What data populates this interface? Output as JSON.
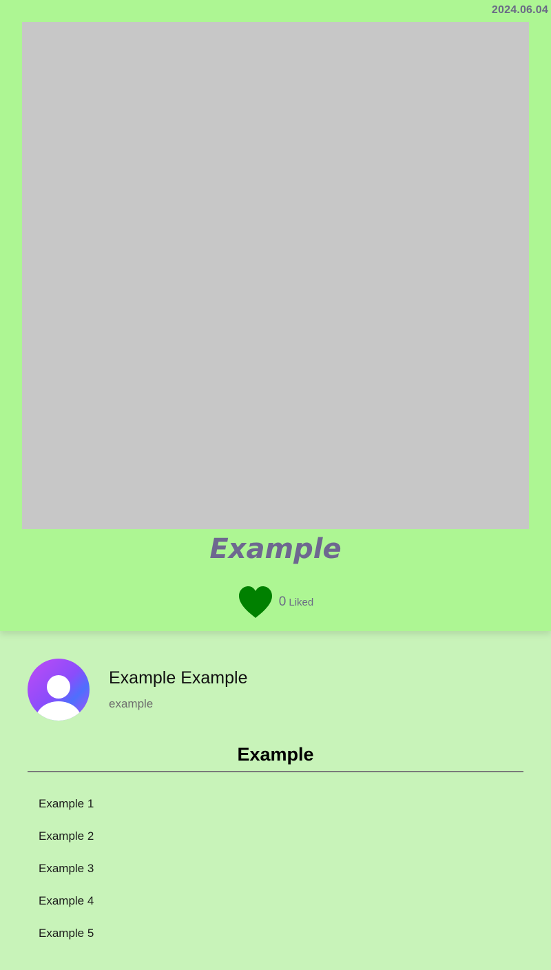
{
  "post": {
    "date": "2024.06.04",
    "title": "Example",
    "likes": {
      "count": "0",
      "label": "Liked",
      "heart_color": "#008000"
    }
  },
  "profile": {
    "name": "Example Example",
    "handle": "example",
    "avatar_icon": "user-avatar-icon"
  },
  "section": {
    "title": "Example",
    "items": [
      {
        "label": "Example 1"
      },
      {
        "label": "Example 2"
      },
      {
        "label": "Example 3"
      },
      {
        "label": "Example 4"
      },
      {
        "label": "Example 5"
      }
    ]
  },
  "colors": {
    "card_bg": "#adf693",
    "page_bg": "#c8f3b9",
    "photo_placeholder": "#c7c7c7",
    "accent_text": "#6e6790"
  }
}
